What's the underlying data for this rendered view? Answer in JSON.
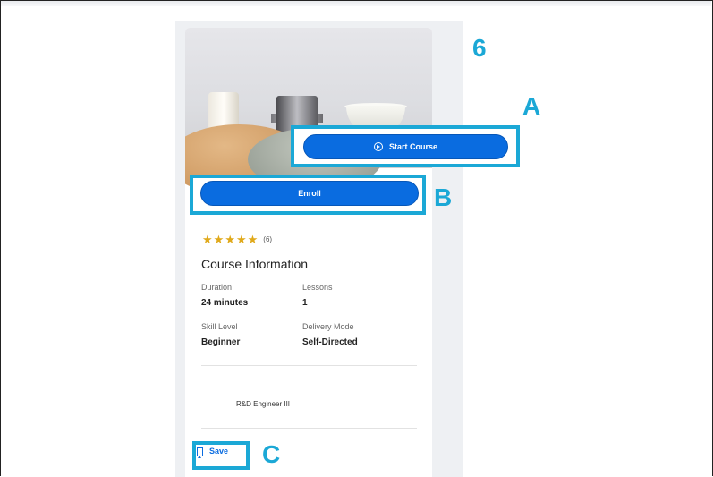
{
  "callouts": {
    "step": "6",
    "a": "A",
    "b": "B",
    "c": "C"
  },
  "course": {
    "start_button": "Start Course",
    "enroll_button": "Enroll",
    "rating": {
      "stars": 5,
      "count": "(6)"
    },
    "info_title": "Course Information",
    "fields": [
      {
        "label": "Duration",
        "value": "24 minutes"
      },
      {
        "label": "Lessons",
        "value": "1"
      },
      {
        "label": "Skill Level",
        "value": "Beginner"
      },
      {
        "label": "Delivery Mode",
        "value": "Self-Directed"
      }
    ],
    "audience": "R&D Engineer III",
    "save_button": "Save"
  },
  "colors": {
    "primary_button": "#0a6ce0",
    "callout": "#1ba8d6",
    "star": "#e0a91a"
  }
}
